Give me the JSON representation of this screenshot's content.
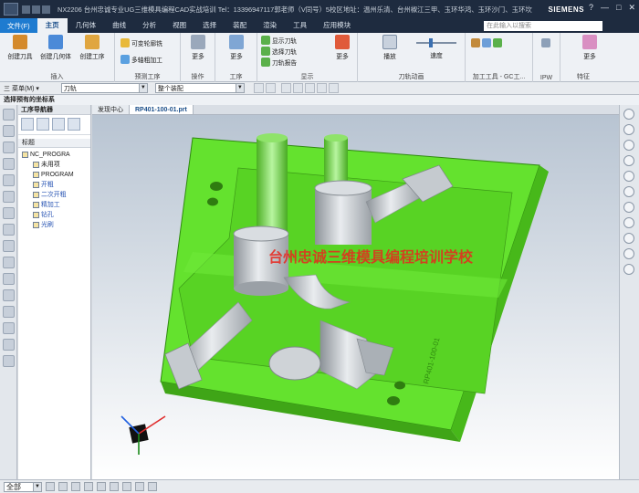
{
  "titlebar": {
    "title": "NX2206 台州忠诚专业UG三维模具编程CAD实战培训 Tel：13396947117郭老师（V同号）5校区地址：温州乐清、台州椒江三甲、玉环华鸿、玉环沙门、玉环坎门",
    "brand": "SIEMENS",
    "controls": [
      "?",
      "—",
      "□",
      "✕"
    ]
  },
  "menu": {
    "file": "文件(F)",
    "tabs": [
      "主页",
      "几何体",
      "曲线",
      "分析",
      "视图",
      "选择",
      "装配",
      "渲染",
      "工具",
      "应用模块"
    ],
    "active": "主页",
    "search_placeholder": "在此输入以搜索"
  },
  "ribbon": {
    "groups": [
      {
        "label": "插入",
        "buttons": [
          "创建刀具",
          "创建几何体",
          "创建工序"
        ]
      },
      {
        "label": "预测工序",
        "buttons": [
          "可变轮廓铣",
          "多轴粗加工"
        ]
      },
      {
        "label": "操作",
        "buttons": [
          "更多"
        ]
      },
      {
        "label": "工序",
        "buttons": [
          "更多"
        ]
      },
      {
        "label": "显示",
        "buttons": [
          "显示刀轨",
          "选择刀轨",
          "刀轨报告",
          "更多"
        ]
      },
      {
        "label": "刀轨动画",
        "buttons": [
          "播放",
          "速度"
        ]
      },
      {
        "label": "加工工具 - GC工...",
        "buttons": []
      },
      {
        "label": "IPW",
        "buttons": []
      },
      {
        "label": "特征",
        "buttons": [
          "更多"
        ]
      }
    ]
  },
  "selbar": {
    "menu": "三 菜单(M) ▾",
    "filter": "刀轨",
    "scope": "整个装配"
  },
  "hint": "选择预有的坐标系",
  "navigator": {
    "title": "工序导航器",
    "column": "标题",
    "items": [
      {
        "label": "NC_PROGRA",
        "indent": 0
      },
      {
        "label": "未用项",
        "indent": 1
      },
      {
        "label": "PROGRAM",
        "indent": 1
      },
      {
        "label": "开粗",
        "indent": 1,
        "blue": true
      },
      {
        "label": "二次开粗",
        "indent": 1,
        "blue": true
      },
      {
        "label": "精加工",
        "indent": 1,
        "blue": true
      },
      {
        "label": "钻孔",
        "indent": 1,
        "blue": true
      },
      {
        "label": "光刷",
        "indent": 1,
        "blue": true
      }
    ]
  },
  "viewport": {
    "tabs": [
      "发现中心",
      "RP401-100-01.prt"
    ],
    "active_tab": "RP401-100-01.prt",
    "watermark": "台州忠诚三维模具编程培训学校",
    "part_label": "RP401-100-01"
  },
  "statusbar": {
    "filter": "全部"
  },
  "colors": {
    "mold": "#64e22e",
    "metal": "#b9bec4",
    "bg_top": "#b8c4d2",
    "bg_bottom": "#ffffff",
    "watermark": "#e8281f"
  }
}
